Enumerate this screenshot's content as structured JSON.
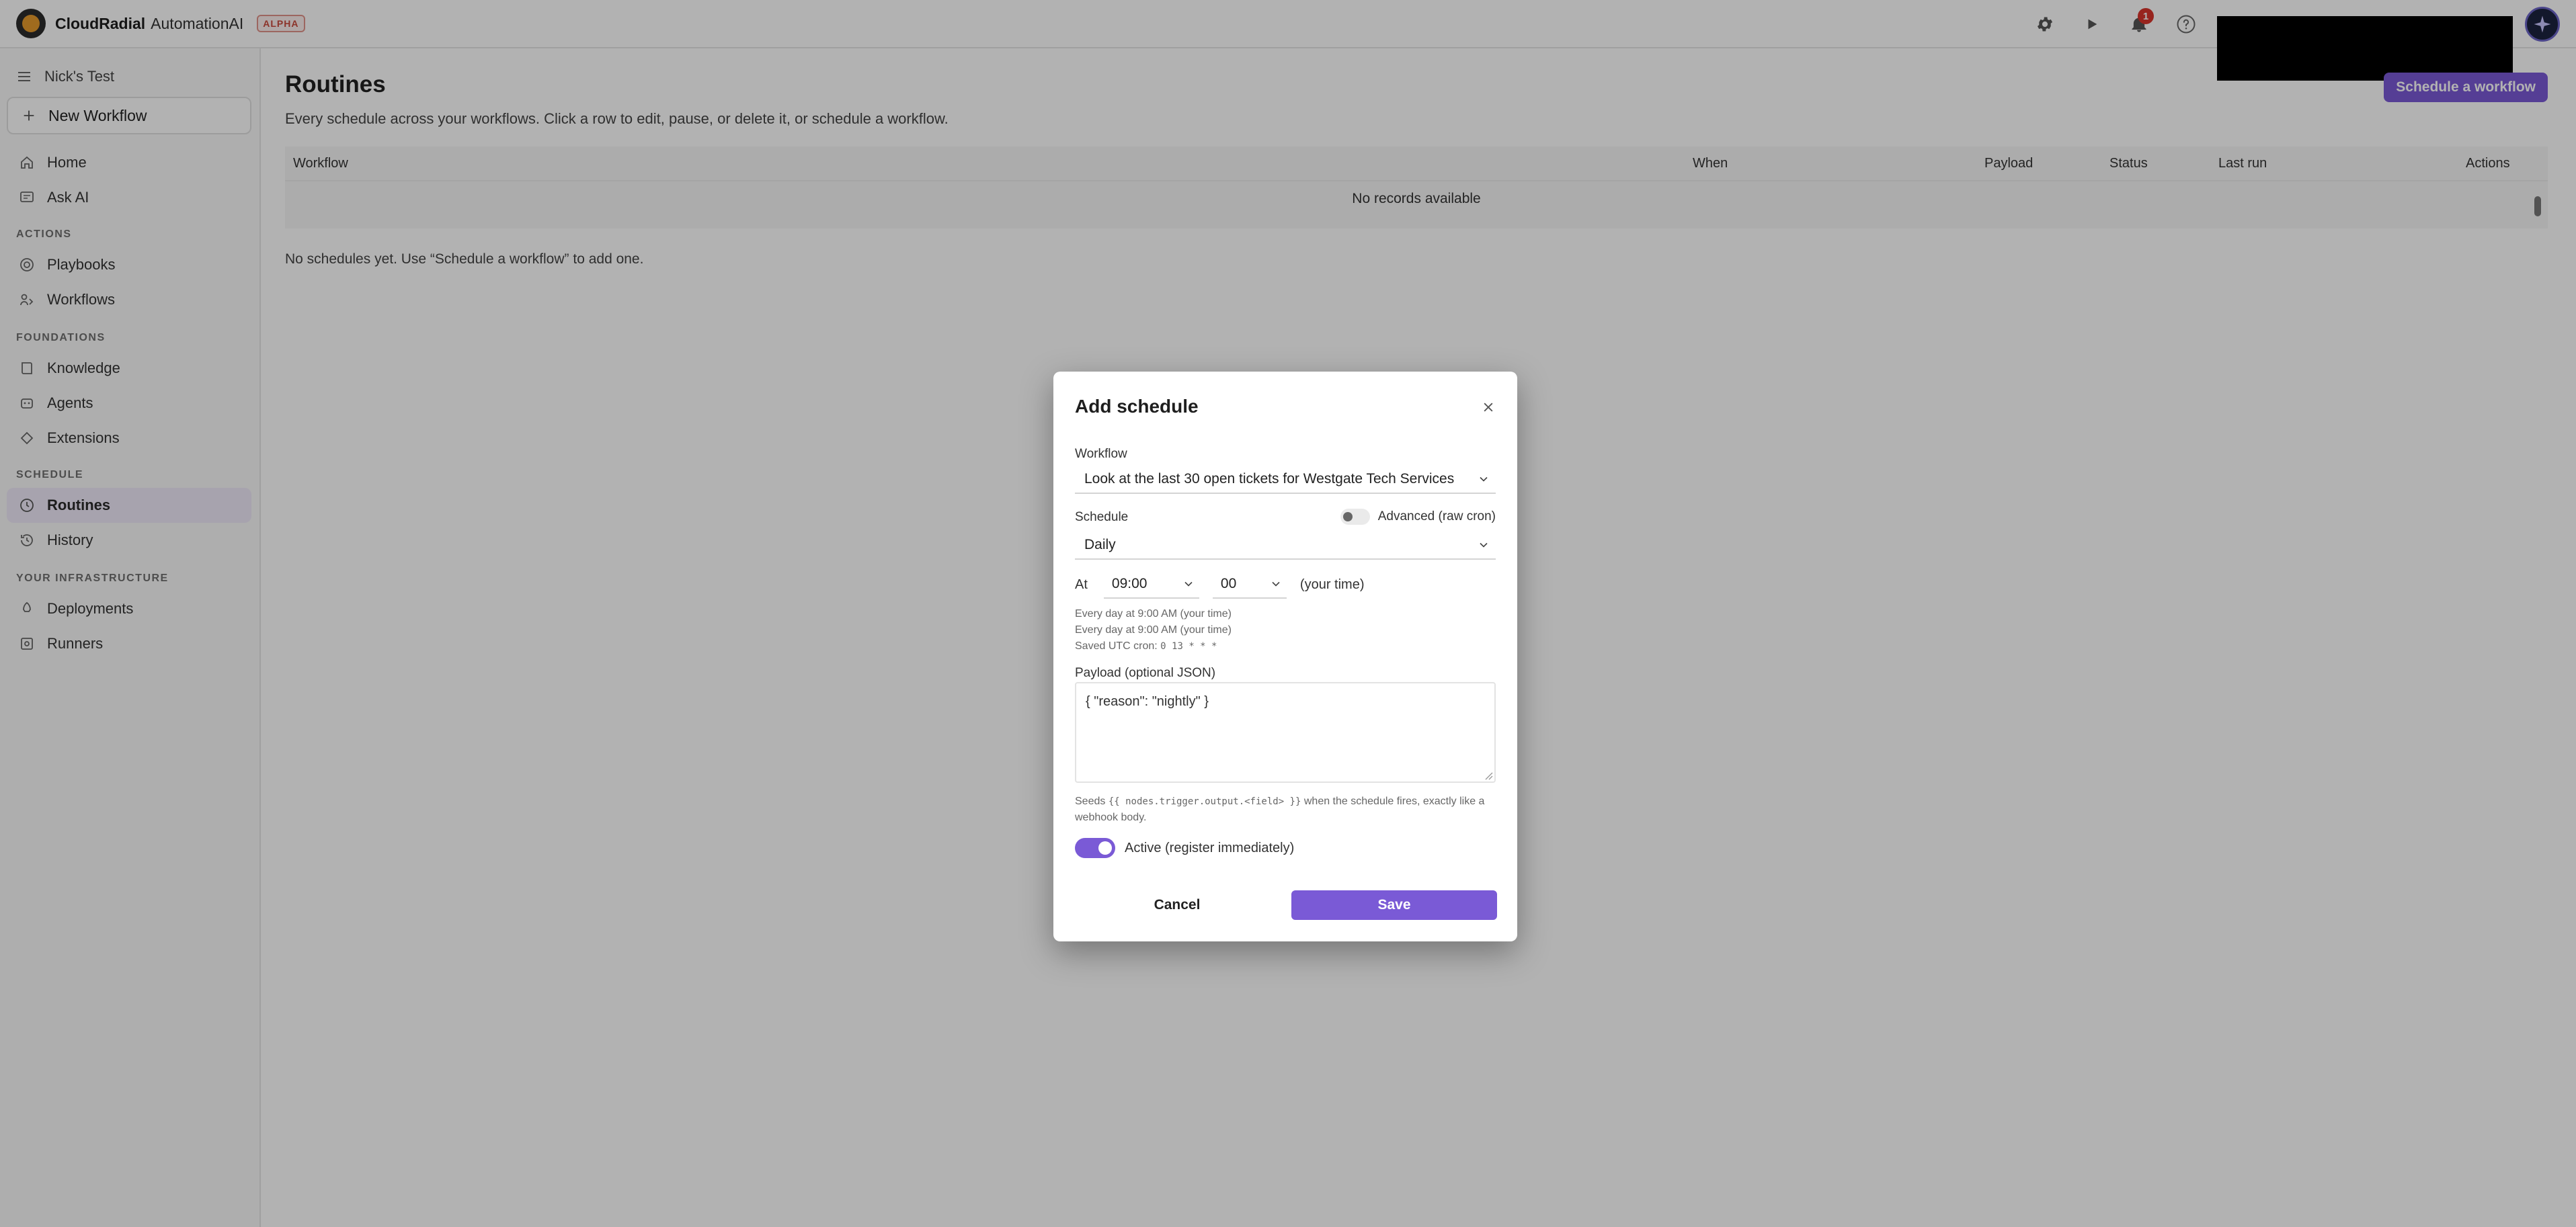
{
  "app": {
    "brand": "CloudRadial",
    "product": "AutomationAI",
    "badge": "ALPHA",
    "notification_count": "1"
  },
  "icons": {
    "logo": "logo-icon",
    "settings": "gear-icon",
    "run": "play-icon",
    "notifications": "bell-icon",
    "help": "help-icon",
    "menu": "hamburger-icon",
    "add": "plus-icon"
  },
  "sidebar": {
    "workspace": "Nick's Test",
    "new_workflow": "New Workflow",
    "top": [
      {
        "label": "Home",
        "icon": "home-icon"
      },
      {
        "label": "Ask AI",
        "icon": "chat-icon"
      }
    ],
    "actions_title": "ACTIONS",
    "actions": [
      {
        "label": "Playbooks",
        "icon": "target-icon"
      },
      {
        "label": "Workflows",
        "icon": "workflow-icon"
      }
    ],
    "foundations_title": "FOUNDATIONS",
    "foundations": [
      {
        "label": "Knowledge",
        "icon": "book-icon"
      },
      {
        "label": "Agents",
        "icon": "agent-icon"
      },
      {
        "label": "Extensions",
        "icon": "extension-icon"
      }
    ],
    "schedule_title": "SCHEDULE",
    "schedule": [
      {
        "label": "Routines",
        "icon": "clock-icon",
        "active": true
      },
      {
        "label": "History",
        "icon": "history-icon"
      }
    ],
    "infra_title": "YOUR INFRASTRUCTURE",
    "infra": [
      {
        "label": "Deployments",
        "icon": "deploy-icon"
      },
      {
        "label": "Runners",
        "icon": "server-icon"
      }
    ]
  },
  "main": {
    "title": "Routines",
    "subtitle": "Every schedule across your workflows. Click a row to edit, pause, or delete it, or schedule a workflow.",
    "schedule_button": "Schedule a workflow",
    "table": {
      "columns": [
        "Workflow",
        "When",
        "Payload",
        "Status",
        "Last run",
        "Actions"
      ],
      "empty": "No records available"
    },
    "empty_note": "No schedules yet. Use “Schedule a workflow” to add one."
  },
  "modal": {
    "title": "Add schedule",
    "workflow_label": "Workflow",
    "workflow_value": "Look at the last 30 open tickets for Westgate Tech Services",
    "schedule_label": "Schedule",
    "advanced_label": "Advanced (raw cron)",
    "schedule_value": "Daily",
    "at_label": "At",
    "hour_value": "09:00",
    "minute_value": "00",
    "your_time": "(your time)",
    "hint_1": "Every day at 9:00 AM (your time)",
    "hint_2": "Every day at 9:00 AM (your time)",
    "hint_cron_prefix": "Saved UTC cron:",
    "hint_cron_value": "0 13 * * *",
    "payload_label": "Payload (optional JSON)",
    "payload_value": "{ \"reason\": \"nightly\" }",
    "seeds_prefix": "Seeds",
    "seeds_code": "{{ nodes.trigger.output.<field> }}",
    "seeds_suffix": "when the schedule fires, exactly like a webhook body.",
    "active_label": "Active (register immediately)",
    "cancel": "Cancel",
    "save": "Save"
  },
  "colors": {
    "accent": "#7a5ad6",
    "active_nav_bg": "#efeaf9",
    "badge_red": "#d9342b"
  }
}
